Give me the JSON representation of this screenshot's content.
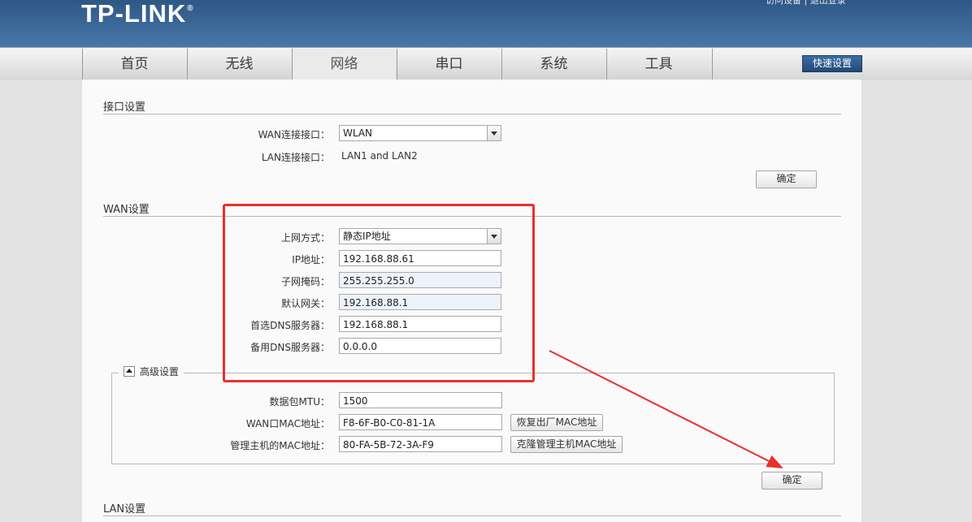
{
  "header": {
    "logo": "TP-LINK",
    "logo_mark": "®",
    "top_links": "访问设备 | 退出登录"
  },
  "nav": {
    "tabs": [
      "首页",
      "无线",
      "网络",
      "串口",
      "系统",
      "工具"
    ],
    "active_tab": "网络",
    "quick_setup": "快速设置"
  },
  "interface_section": {
    "title": "接口设置",
    "wan_label": "WAN连接接口：",
    "wan_value": "WLAN",
    "lan_label": "LAN连接接口：",
    "lan_value": "LAN1 and LAN2",
    "confirm": "确定"
  },
  "wan_section": {
    "title": "WAN设置",
    "fields": {
      "mode_label": "上网方式：",
      "mode_value": "静态IP地址",
      "ip_label": "IP地址：",
      "ip_value": "192.168.88.61",
      "mask_label": "子网掩码：",
      "mask_value": "255.255.255.0",
      "gateway_label": "默认网关：",
      "gateway_value": "192.168.88.1",
      "dns1_label": "首选DNS服务器：",
      "dns1_value": "192.168.88.1",
      "dns2_label": "备用DNS服务器：",
      "dns2_value": "0.0.0.0"
    },
    "advanced": {
      "title": "高级设置",
      "mtu_label": "数据包MTU：",
      "mtu_value": "1500",
      "wan_mac_label": "WAN口MAC地址：",
      "wan_mac_value": "F8-6F-B0-C0-81-1A",
      "restore_mac_button": "恢复出厂MAC地址",
      "host_mac_label": "管理主机的MAC地址：",
      "host_mac_value": "80-FA-5B-72-3A-F9",
      "clone_mac_button": "克隆管理主机MAC地址"
    },
    "confirm": "确定"
  },
  "lan_section": {
    "title": "LAN设置"
  },
  "colors": {
    "header_blue": "#3d6a9a",
    "annotation_red": "#e8302c",
    "quick_button": "#2b5a8f"
  }
}
